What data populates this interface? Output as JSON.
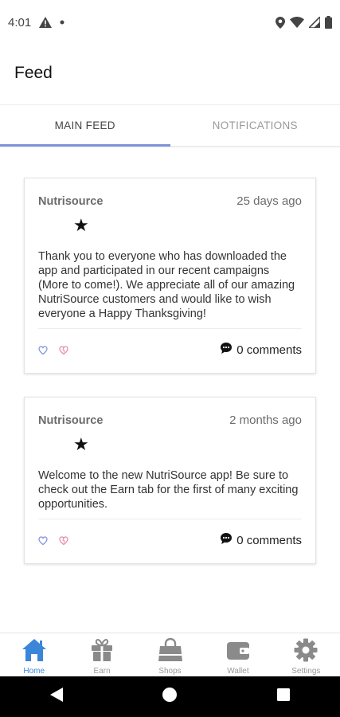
{
  "status_bar": {
    "time": "4:01",
    "icons": [
      "alert-icon",
      "dot-icon",
      "location-icon",
      "wifi-icon",
      "signal-icon",
      "battery-icon"
    ]
  },
  "header": {
    "title": "Feed"
  },
  "tabs": [
    {
      "label": "MAIN FEED",
      "active": true
    },
    {
      "label": "NOTIFICATIONS",
      "active": false
    }
  ],
  "posts": [
    {
      "author": "Nutrisource",
      "date": "25 days ago",
      "star": "★",
      "body": "Thank you to everyone who has downloaded the app and participated in our recent campaigns (More to come!). We appreciate all of our amazing NutriSource customers and would like to wish everyone a Happy Thanksgiving!",
      "comments": "0 comments"
    },
    {
      "author": "Nutrisource",
      "date": "2 months ago",
      "star": "★",
      "body": "Welcome to the new NutriSource app! Be sure to check out the Earn tab for the first of many exciting opportunities.",
      "comments": "0 comments"
    }
  ],
  "bottom_nav": [
    {
      "label": "Home",
      "icon": "home-icon",
      "active": true
    },
    {
      "label": "Earn",
      "icon": "gift-icon",
      "active": false
    },
    {
      "label": "Shops",
      "icon": "shopping-bag-icon",
      "active": false
    },
    {
      "label": "Wallet",
      "icon": "wallet-icon",
      "active": false
    },
    {
      "label": "Settings",
      "icon": "gear-icon",
      "active": false
    }
  ],
  "colors": {
    "accent": "#3b86d8",
    "tab_indicator": "#7b93d6",
    "like_icon": "#7b8fe0",
    "dislike_icon": "#e58aa0",
    "nav_icon": "#8a8a8a"
  }
}
